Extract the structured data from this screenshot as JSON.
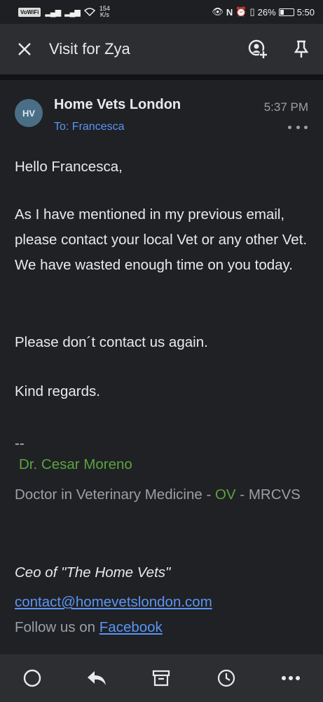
{
  "status_bar": {
    "volte": "VoWiFi",
    "speed": "154",
    "speed_unit": "K/s",
    "battery": "26%",
    "time": "5:50"
  },
  "app_bar": {
    "title": "Visit for Zya",
    "icons": [
      "close-icon",
      "add-task-icon",
      "pin-icon"
    ]
  },
  "email": {
    "avatar_initials": "HV",
    "sender": "Home Vets London",
    "to": "To: Francesca",
    "time": "5:37 PM",
    "greeting": "Hello Francesca,",
    "paragraph1": "As I have mentioned in my previous email, please contact your local Vet or any other Vet. We have wasted enough time on you today.",
    "paragraph2": "Please don´t contact us again.",
    "closing": "Kind regards.",
    "sig_separator": "--",
    "sig_name": "Dr. Cesar Moreno",
    "sig_title_part1": "Doctor in Veterinary Medicine - ",
    "sig_title_ov": "OV",
    "sig_title_part2": " - MRCVS",
    "ceo_line": "Ceo of \"The Home Vets\"",
    "email_address": "contact@homevetslondon.com",
    "follow_prefix": "Follow us on ",
    "facebook": "Facebook"
  },
  "bottom_bar": {
    "icons": [
      "circle-icon",
      "reply-icon",
      "archive-icon",
      "snooze-icon",
      "more-icon"
    ]
  },
  "colors": {
    "background": "#202124",
    "link": "#5a95f5",
    "signature_green": "#5aa33f",
    "avatar": "#4a6e86"
  }
}
